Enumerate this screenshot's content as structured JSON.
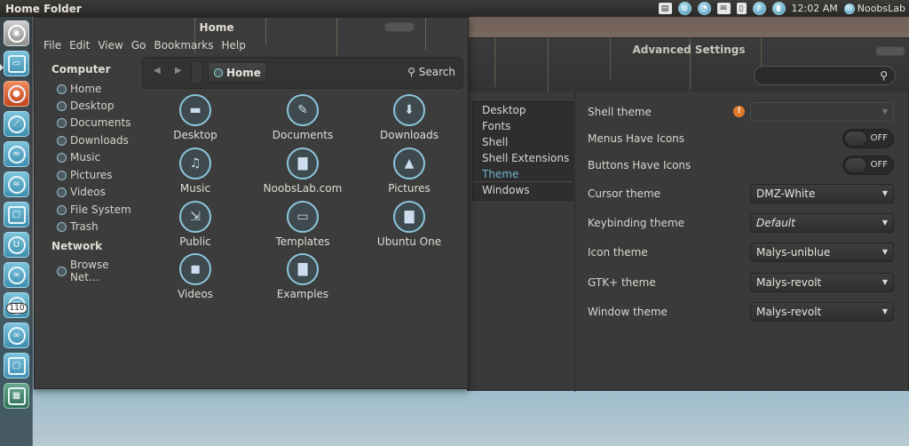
{
  "top_panel": {
    "title": "Home Folder",
    "clock": "12:02 AM",
    "user": "NoobsLab",
    "tray_icons": [
      "keyboard-indicator-icon",
      "ubuntu-one-icon",
      "network-icon",
      "mail-icon",
      "clipboard-icon",
      "sound-icon",
      "battery-icon"
    ]
  },
  "launcher": {
    "badge": "110",
    "items": [
      "dash-home-icon",
      "files-icon",
      "firefox-icon",
      "app-icon-1",
      "app-icon-2",
      "app-icon-3",
      "app-icon-4",
      "ubuntu-one-icon",
      "app-icon-5",
      "app-icon-6",
      "app-icon-7",
      "app-icon-8",
      "workspace-switcher-icon"
    ]
  },
  "home_window": {
    "title": "Home",
    "menu": [
      "File",
      "Edit",
      "View",
      "Go",
      "Bookmarks",
      "Help"
    ],
    "sidebar": {
      "computer_title": "Computer",
      "computer_items": [
        "Home",
        "Desktop",
        "Documents",
        "Downloads",
        "Music",
        "Pictures",
        "Videos",
        "File System",
        "Trash"
      ],
      "network_title": "Network",
      "network_items": [
        "Browse Net…"
      ]
    },
    "location": "Home",
    "search_label": "Search",
    "folders": [
      {
        "name": "Desktop",
        "icon": "desktop-folder-icon",
        "glyph": "▬"
      },
      {
        "name": "Documents",
        "icon": "documents-folder-icon",
        "glyph": "✎"
      },
      {
        "name": "Downloads",
        "icon": "downloads-folder-icon",
        "glyph": "⬇"
      },
      {
        "name": "Music",
        "icon": "music-folder-icon",
        "glyph": "♫"
      },
      {
        "name": "NoobsLab.com",
        "icon": "folder-icon",
        "glyph": "▇"
      },
      {
        "name": "Pictures",
        "icon": "pictures-folder-icon",
        "glyph": "▲"
      },
      {
        "name": "Public",
        "icon": "public-folder-icon",
        "glyph": "⇲"
      },
      {
        "name": "Templates",
        "icon": "templates-folder-icon",
        "glyph": "▭"
      },
      {
        "name": "Ubuntu One",
        "icon": "ubuntu-one-folder-icon",
        "glyph": "▇"
      },
      {
        "name": "Videos",
        "icon": "videos-folder-icon",
        "glyph": "◼"
      },
      {
        "name": "Examples",
        "icon": "examples-folder-icon",
        "glyph": "▇"
      }
    ]
  },
  "adv_window": {
    "title": "Advanced Settings",
    "sidebar": [
      "Desktop",
      "Fonts",
      "Shell",
      "Shell Extensions",
      "Theme",
      "Windows"
    ],
    "active_item": "Theme",
    "settings": {
      "shell_theme": {
        "label": "Shell theme",
        "value": ""
      },
      "menus_have_icons": {
        "label": "Menus Have Icons",
        "state": "OFF"
      },
      "buttons_have_icons": {
        "label": "Buttons Have Icons",
        "state": "OFF"
      },
      "cursor_theme": {
        "label": "Cursor theme",
        "value": "DMZ-White"
      },
      "keybinding_theme": {
        "label": "Keybinding theme",
        "value": "Default"
      },
      "icon_theme": {
        "label": "Icon theme",
        "value": "Malys-uniblue"
      },
      "gtk_theme": {
        "label": "GTK+ theme",
        "value": "Malys-revolt"
      },
      "window_theme": {
        "label": "Window theme",
        "value": "Malys-revolt"
      }
    }
  }
}
